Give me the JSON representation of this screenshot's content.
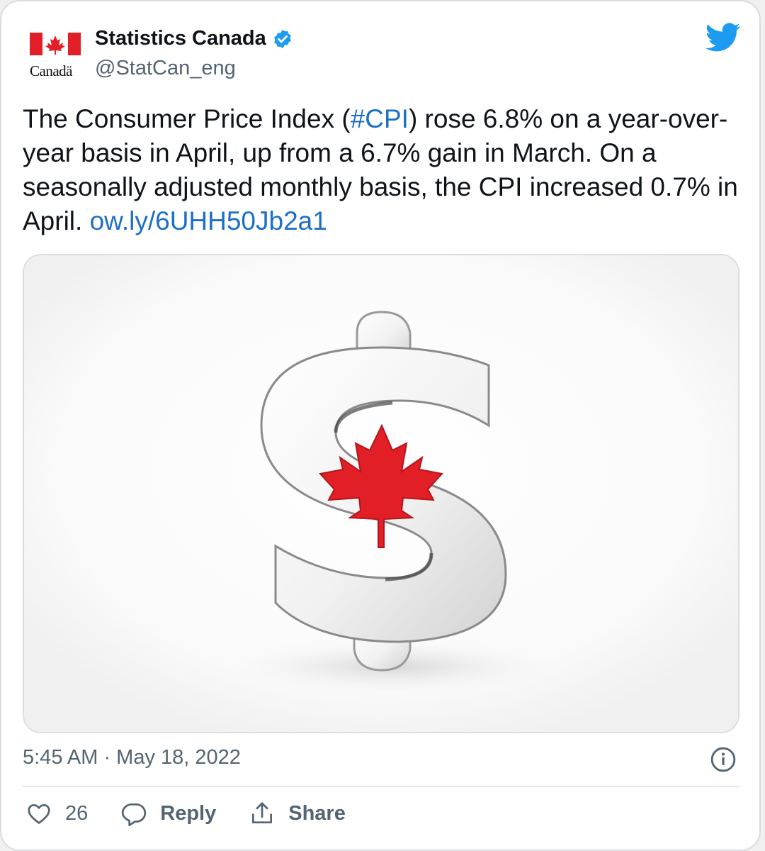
{
  "account": {
    "display_name": "Statistics Canada",
    "handle": "@StatCan_eng",
    "logo_wordmark": "Canadä",
    "verified_icon": "verified-badge-icon",
    "brand_icon": "twitter-bird-icon"
  },
  "tweet": {
    "text_before": "The Consumer Price Index (",
    "hashtag": "#CPI",
    "text_after": ") rose 6.8% on a year-over-year basis in April, up from a 6.7% gain in March. On a seasonally adjusted monthly basis, the CPI increased 0.7% in April. ",
    "link": "ow.ly/6UHH50Jb2a1"
  },
  "meta": {
    "timestamp": "5:45 AM · May 18, 2022"
  },
  "actions": {
    "likes": "26",
    "reply": "Reply",
    "share": "Share"
  },
  "colors": {
    "link": "#1b6fc6",
    "twitter_blue": "#1d9bf0",
    "flag_red": "#e21f26",
    "text_secondary": "#536471"
  }
}
